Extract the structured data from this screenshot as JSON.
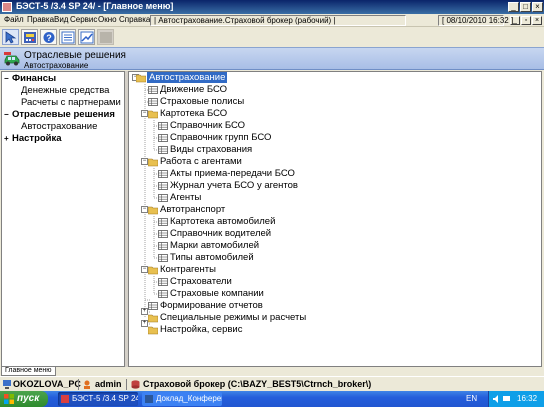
{
  "window": {
    "title": "БЭСТ-5 /3.4 SP 24/ - [Главное меню]"
  },
  "menu": {
    "items": [
      "Файл",
      "Правка",
      "Вид",
      "Сервис",
      "Окно",
      "Справка"
    ],
    "status_company": "| Автострахование.Страховой брокер (рабочий) |",
    "status_datetime": "[ 08/10/2010 16:32 ]"
  },
  "toolbar": {
    "buttons": [
      "pointer-icon",
      "calculator-icon",
      "help-icon",
      "list-icon",
      "chart-icon",
      "disabled-icon"
    ]
  },
  "header": {
    "title": "Отраслевые решения",
    "subtitle": "Автострахование"
  },
  "left_panel": {
    "items": [
      {
        "label": "Финансы",
        "type": "group",
        "expander": "−"
      },
      {
        "label": "Денежные средства",
        "type": "item"
      },
      {
        "label": "Расчеты с партнерами",
        "type": "item"
      },
      {
        "label": "Отраслевые решения",
        "type": "group",
        "expander": "−"
      },
      {
        "label": "Автострахование",
        "type": "item"
      },
      {
        "label": "Настройка",
        "type": "group",
        "expander": "+"
      }
    ]
  },
  "tree": {
    "nodes": [
      {
        "label": "Автострахование",
        "level": 0,
        "kind": "folder",
        "selected": true
      },
      {
        "label": "Движение БСО",
        "level": 1,
        "kind": "doc"
      },
      {
        "label": "Страховые полисы",
        "level": 1,
        "kind": "doc"
      },
      {
        "label": "Картотека БСО",
        "level": 1,
        "kind": "folder"
      },
      {
        "label": "Справочник БСО",
        "level": 2,
        "kind": "doc"
      },
      {
        "label": "Справочник групп БСО",
        "level": 2,
        "kind": "doc"
      },
      {
        "label": "Виды страхования",
        "level": 2,
        "kind": "doc"
      },
      {
        "label": "Работа с агентами",
        "level": 1,
        "kind": "folder"
      },
      {
        "label": "Акты приема-передачи БСО",
        "level": 2,
        "kind": "doc"
      },
      {
        "label": "Журнал учета БСО у агентов",
        "level": 2,
        "kind": "doc"
      },
      {
        "label": "Агенты",
        "level": 2,
        "kind": "doc"
      },
      {
        "label": "Автотранспорт",
        "level": 1,
        "kind": "folder"
      },
      {
        "label": "Картотека автомобилей",
        "level": 2,
        "kind": "doc"
      },
      {
        "label": "Справочник водителей",
        "level": 2,
        "kind": "doc"
      },
      {
        "label": "Марки автомобилей",
        "level": 2,
        "kind": "doc"
      },
      {
        "label": "Типы автомобилей",
        "level": 2,
        "kind": "doc"
      },
      {
        "label": "Контрагенты",
        "level": 1,
        "kind": "folder"
      },
      {
        "label": "Страхователи",
        "level": 2,
        "kind": "doc"
      },
      {
        "label": "Страховые компании",
        "level": 2,
        "kind": "doc"
      },
      {
        "label": "Формирование отчетов",
        "level": 1,
        "kind": "doc"
      },
      {
        "label": "Специальные режимы и расчеты",
        "level": 1,
        "kind": "folder-collapsed"
      },
      {
        "label": "Настройка, сервис",
        "level": 1,
        "kind": "folder-collapsed"
      }
    ]
  },
  "bottom_tab": {
    "label": "Главное меню"
  },
  "statusbar": {
    "computer": "OKOZLOVA_PC",
    "user": "admin",
    "database": "Страховой брокер (C:\\BAZY_BEST5\\Ctrnch_broker\\)"
  },
  "taskbar": {
    "start_label": "пуск",
    "tasks": [
      "БЭСТ-5 /3.4 SP 24/",
      "Доклад_Конференц..."
    ],
    "language": "EN",
    "clock": "16:32"
  },
  "colors": {
    "title_bar": "#0A246A",
    "selection": "#316AC5",
    "header_band": "#B7C9EB",
    "taskbar": "#245EDB",
    "start_button": "#3A9A3A",
    "folder": "#E8C050"
  }
}
